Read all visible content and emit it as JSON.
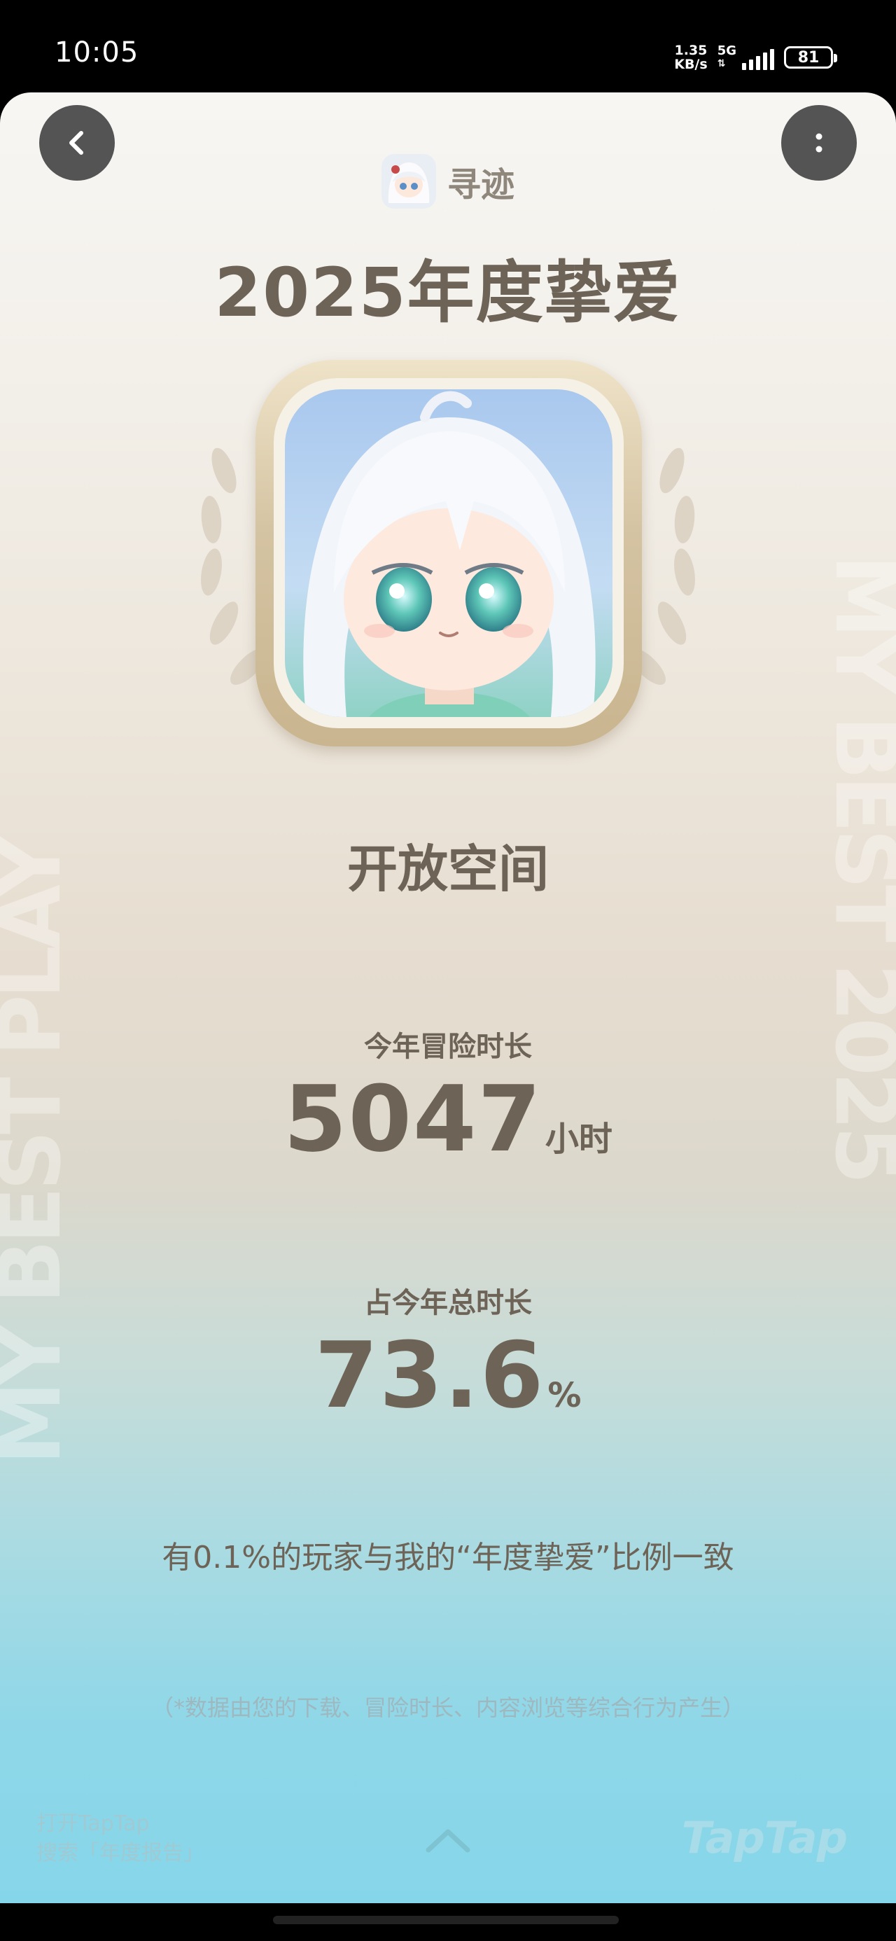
{
  "status": {
    "time": "10:05",
    "net_speed_value": "1.35",
    "net_speed_unit": "KB/s",
    "network": "5G",
    "battery": "81"
  },
  "header": {
    "app_name": "寻迹",
    "title": "2025年度挚爱"
  },
  "game": {
    "name": "开放空间"
  },
  "stats": {
    "playtime_label": "今年冒险时长",
    "playtime_value": "5047",
    "playtime_unit": "小时",
    "share_label": "占今年总时长",
    "share_value": "73.6",
    "share_unit": "%"
  },
  "comparison_text": "有0.1%的玩家与我的“年度挚爱”比例一致",
  "footnote": "（*数据由您的下载、冒险时长、内容浏览等综合行为产生）",
  "footer": {
    "hint_line1": "打开TapTap",
    "hint_line2": "搜索「年度报告」",
    "brand": "TapTap"
  },
  "decor": {
    "left_text": "MY BEST PLAY",
    "right_text": "MY BEST 2025"
  },
  "icons": {
    "back": "chevron-left-icon",
    "more": "more-vertical-icon",
    "scroll_up": "chevron-up-icon"
  },
  "colors": {
    "title_text": "#6d6356",
    "gold_frame": "#d4c3a2",
    "bottom_gradient": "#86d6ea"
  }
}
